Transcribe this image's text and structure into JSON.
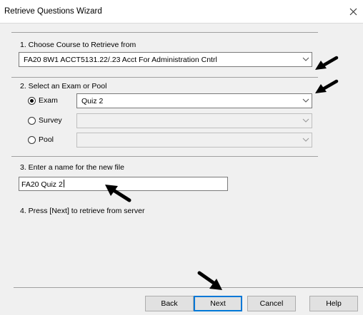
{
  "window": {
    "title": "Retrieve Questions Wizard"
  },
  "icons": {
    "close": "close-icon",
    "chevron": "chevron-down-icon",
    "pointer": "black-pointer-arrow-icon"
  },
  "step1": {
    "label": "1.  Choose Course to Retrieve from",
    "course_value": "FA20 8W1 ACCT5131.22/.23 Acct For Administration Cntrl"
  },
  "step2": {
    "label": "2.  Select an Exam or Pool",
    "options": [
      {
        "label": "Exam",
        "checked": true,
        "value": "Quiz 2"
      },
      {
        "label": "Survey",
        "checked": false,
        "value": ""
      },
      {
        "label": "Pool",
        "checked": false,
        "value": ""
      }
    ]
  },
  "step3": {
    "label": "3.  Enter a name for the new file",
    "file_name": "FA20 Quiz 2"
  },
  "step4": {
    "label": "4.  Press [Next] to retrieve from server"
  },
  "buttons": {
    "back": "Back",
    "next": "Next",
    "cancel": "Cancel",
    "help": "Help"
  },
  "colors": {
    "dialog_bg": "#f0f0f0",
    "default_button_border": "#0078d7"
  }
}
